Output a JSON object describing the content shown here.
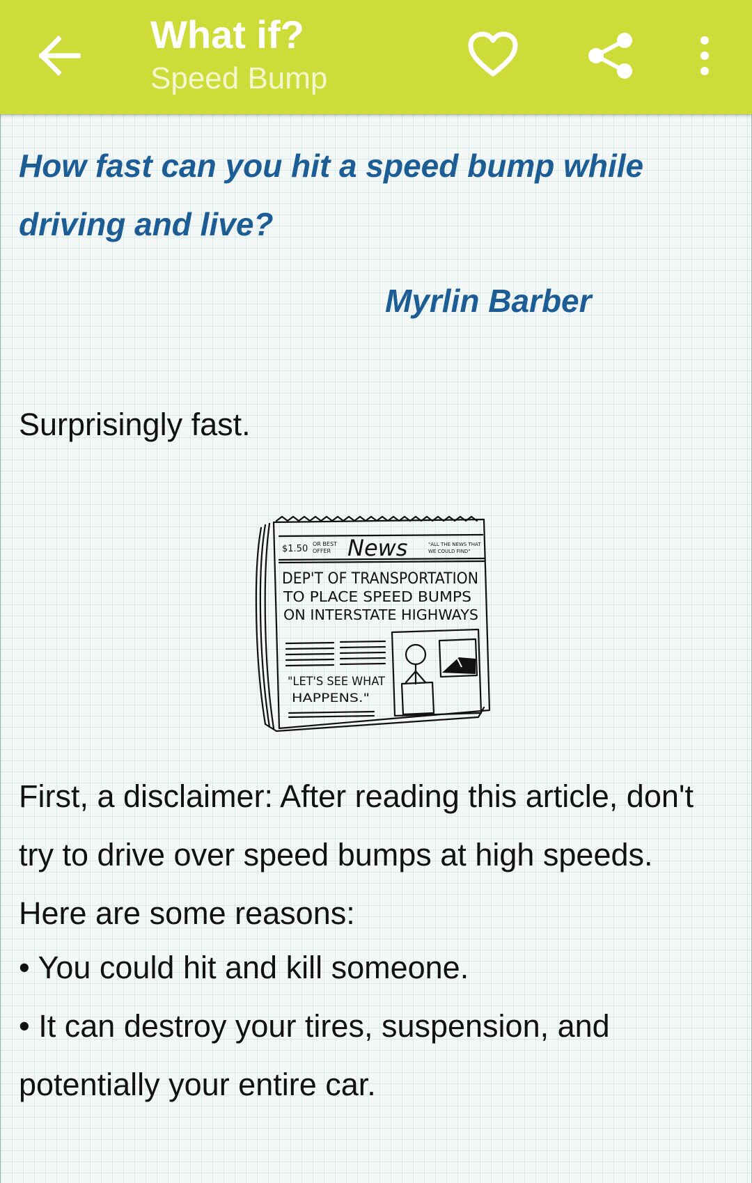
{
  "app_bar": {
    "title": "What if?",
    "subtitle": "Speed Bump",
    "background_color": "#cddc39",
    "icons": [
      "arrow-back-icon",
      "heart-outline-icon",
      "share-icon",
      "more-vertical-icon"
    ]
  },
  "article": {
    "question": "How fast can you hit a speed bump while driving and live?",
    "author": "Myrlin Barber",
    "answer_intro": "Surprisingly fast.",
    "comic": {
      "price": "$1.50",
      "price_note_1": "OR BEST",
      "price_note_2": "OFFER",
      "masthead": "News",
      "tagline_1": "\"ALL THE NEWS THAT",
      "tagline_2": "WE COULD FIND\"",
      "headline_1": "DEP'T OF TRANSPORTATION",
      "headline_2": "TO PLACE SPEED BUMPS",
      "headline_3": "ON INTERSTATE HIGHWAYS",
      "quote_1": "\"LET'S SEE WHAT",
      "quote_2": "HAPPENS.\""
    },
    "disclaimer": "First, a disclaimer: After reading this article, don't try to drive over speed bumps at high speeds. Here are some reasons:",
    "reasons": [
      "• You could hit and kill someone.",
      "• It can destroy your tires, suspension, and potentially your entire car."
    ],
    "accent_color": "#1d5d96"
  }
}
